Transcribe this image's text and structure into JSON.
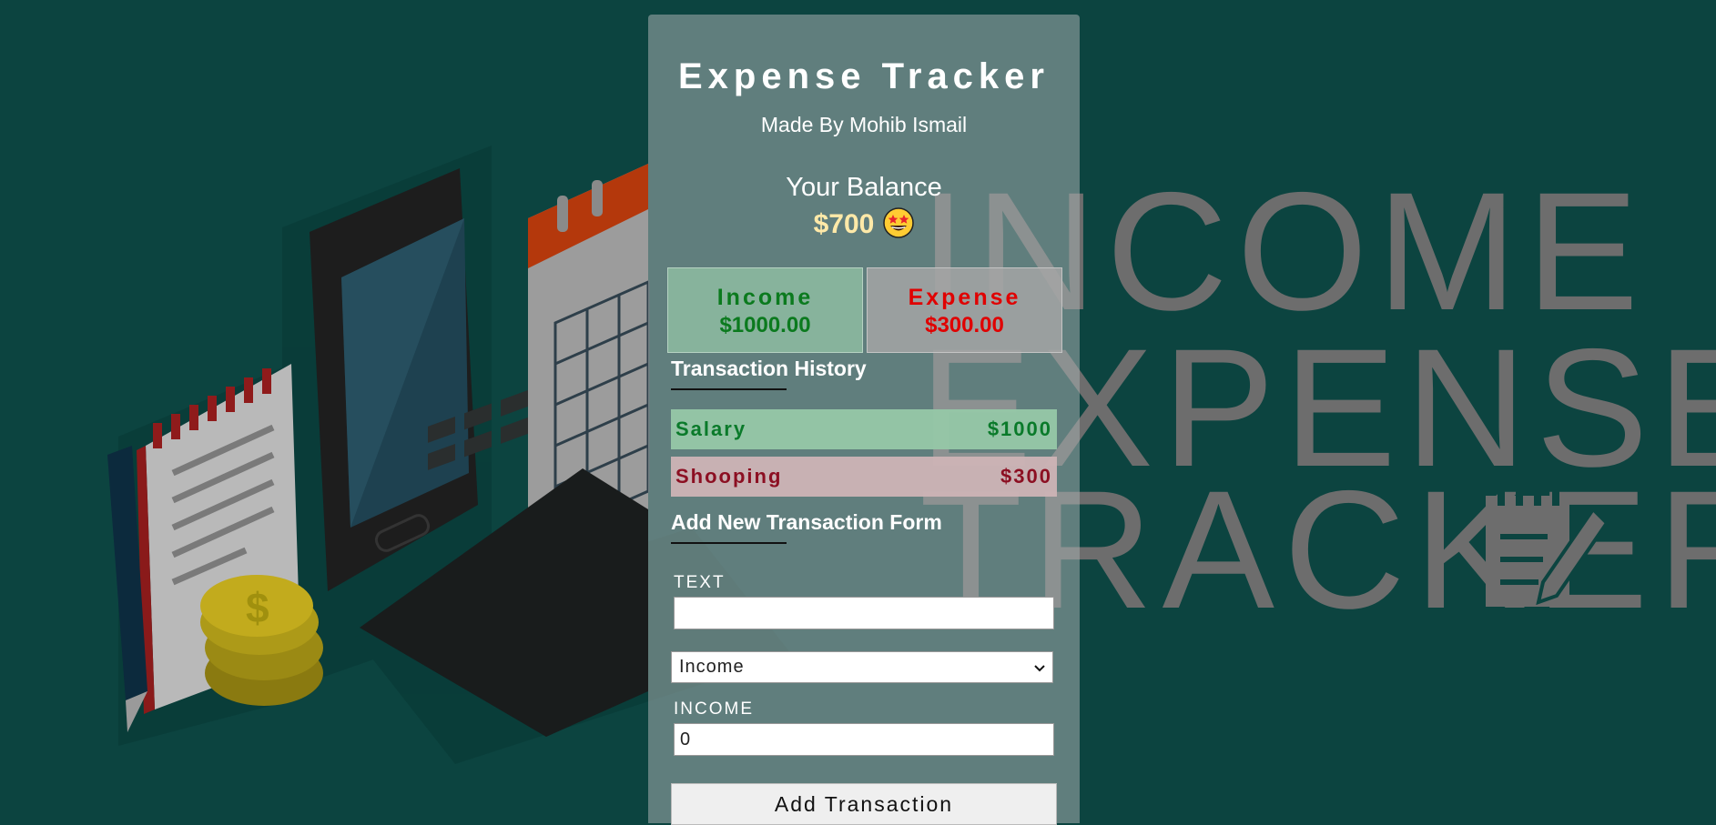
{
  "app": {
    "title": "Expense Tracker",
    "subtitle": "Made By Mohib Ismail"
  },
  "balance": {
    "label": "Your Balance",
    "value": "$700",
    "emoji": "star-struck-face-icon"
  },
  "summary": {
    "income_label": "Income",
    "income_value": "$1000.00",
    "expense_label": "Expense",
    "expense_value": "$300.00"
  },
  "history": {
    "heading": "Transaction History",
    "items": [
      {
        "name": "Salary",
        "amount": "$1000",
        "type": "income"
      },
      {
        "name": "Shooping",
        "amount": "$300",
        "type": "expense"
      }
    ]
  },
  "form": {
    "heading": "Add New Transaction Form",
    "text_label": "TEXT",
    "text_value": "",
    "type_selected": "Income",
    "amount_label": "INCOME",
    "amount_value": "0",
    "submit_label": "Add Transaction"
  },
  "background": {
    "logo_lines": [
      "INCOME",
      "EXPENSE",
      "TRACKER"
    ]
  },
  "colors": {
    "background": "#0c4440",
    "income": "#0b7a1e",
    "expense": "#e00000",
    "balance": "#ffe9a8"
  }
}
